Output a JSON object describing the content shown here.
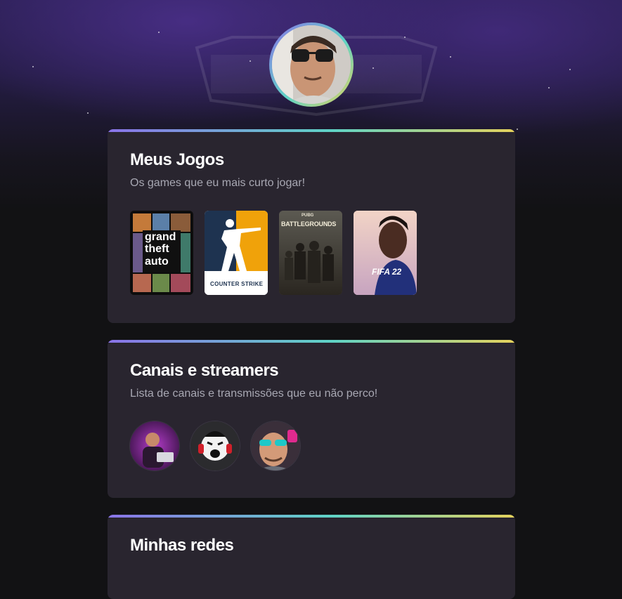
{
  "profile": {
    "avatar_icon": "user-photo"
  },
  "sections": {
    "games": {
      "title": "Meus Jogos",
      "subtitle": "Os games que eu mais curto jogar!",
      "items": [
        {
          "name": "grand theft auto",
          "cover_lines": [
            "grand",
            "theft",
            "auto"
          ],
          "icon": "gta-v-cover"
        },
        {
          "name": "Counter Strike",
          "cover_text": "COUNTER STRIKE",
          "icon": "counter-strike-cover"
        },
        {
          "name": "PUBG Battlegrounds",
          "cover_small": "PUBG",
          "cover_text": "BATTLEGROUNDS",
          "icon": "pubg-cover"
        },
        {
          "name": "FIFA 22",
          "cover_text": "FIFA 22",
          "icon": "fifa22-cover"
        }
      ]
    },
    "streamers": {
      "title": "Canais e streamers",
      "subtitle": "Lista de canais e transmissões que eu não perco!",
      "items": [
        {
          "icon": "streamer-avatar-1"
        },
        {
          "icon": "streamer-avatar-2"
        },
        {
          "icon": "streamer-avatar-3"
        }
      ]
    },
    "socials": {
      "title": "Minhas redes"
    }
  },
  "colors": {
    "background": "#121214",
    "card": "#29252f",
    "gradient_start": "#8a73e8",
    "gradient_mid": "#5fd3c6",
    "gradient_end": "#e5d25c",
    "title": "#ffffff",
    "subtitle": "#a8a8b3"
  }
}
